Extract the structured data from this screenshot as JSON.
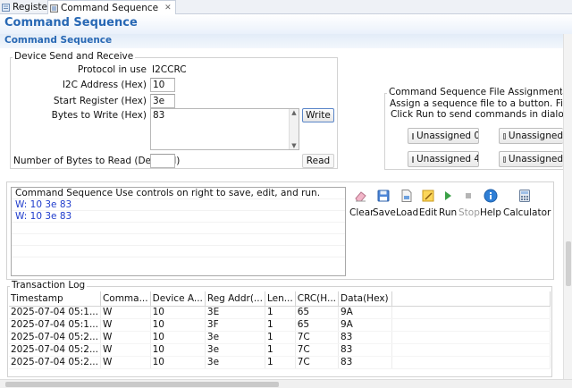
{
  "tabs": [
    {
      "label": "Registers"
    },
    {
      "label": "Command Sequence"
    }
  ],
  "header": {
    "title": "Command Sequence",
    "subtitle": "Command Sequence"
  },
  "device": {
    "group_title": "Device Send and Receive",
    "protocol_label": "Protocol in use",
    "protocol_value": "I2CCRC",
    "address_label": "I2C Address (Hex)",
    "address_value": "10",
    "start_reg_label": "Start Register (Hex)",
    "start_reg_value": "3e",
    "bytes_write_label": "Bytes to Write (Hex)",
    "bytes_write_value": "83",
    "write_button": "Write",
    "bytes_read_label": "Number of Bytes to Read (Decimal)",
    "bytes_read_value": "",
    "read_button": "Read"
  },
  "assignment": {
    "group_title": "Command Sequence File Assignment Buttons",
    "line1": "Assign a sequence file to a button.  File will lo",
    "line2": "Click Run to send commands in dialog to de",
    "buttons": [
      "Unassigned 0",
      "Unassigned",
      "Unassigned 4",
      "Unassigned"
    ]
  },
  "sequence": {
    "header": "Command Sequence   Use controls on right to save, edit, and run.",
    "lines": [
      "W: 10 3e 83",
      "W: 10 3e 83"
    ]
  },
  "toolbar": {
    "items": [
      {
        "label": "Clear",
        "icon": "eraser-icon"
      },
      {
        "label": "Save",
        "icon": "save-icon"
      },
      {
        "label": "Load",
        "icon": "load-icon"
      },
      {
        "label": "Edit",
        "icon": "edit-icon"
      },
      {
        "label": "Run",
        "icon": "run-icon"
      },
      {
        "label": "Stop",
        "icon": "stop-icon"
      },
      {
        "label": "Help",
        "icon": "help-icon"
      },
      {
        "label": "Calculator",
        "icon": "calculator-icon"
      }
    ]
  },
  "log": {
    "title": "Transaction Log",
    "columns": [
      "Timestamp",
      "Comma...",
      "Device A...",
      "Reg Addr(...",
      "Len...",
      "CRC(H...",
      "Data(Hex)"
    ],
    "rows": [
      [
        "2025-07-04 05:1...",
        "W",
        "10",
        "3E",
        "1",
        "65",
        "9A"
      ],
      [
        "2025-07-04 05:1...",
        "W",
        "10",
        "3F",
        "1",
        "65",
        "9A"
      ],
      [
        "2025-07-04 05:2...",
        "W",
        "10",
        "3e",
        "1",
        "7C",
        "83"
      ],
      [
        "2025-07-04 05:2...",
        "W",
        "10",
        "3e",
        "1",
        "7C",
        "83"
      ],
      [
        "2025-07-04 05:2...",
        "W",
        "10",
        "3e",
        "1",
        "7C",
        "83"
      ]
    ]
  }
}
